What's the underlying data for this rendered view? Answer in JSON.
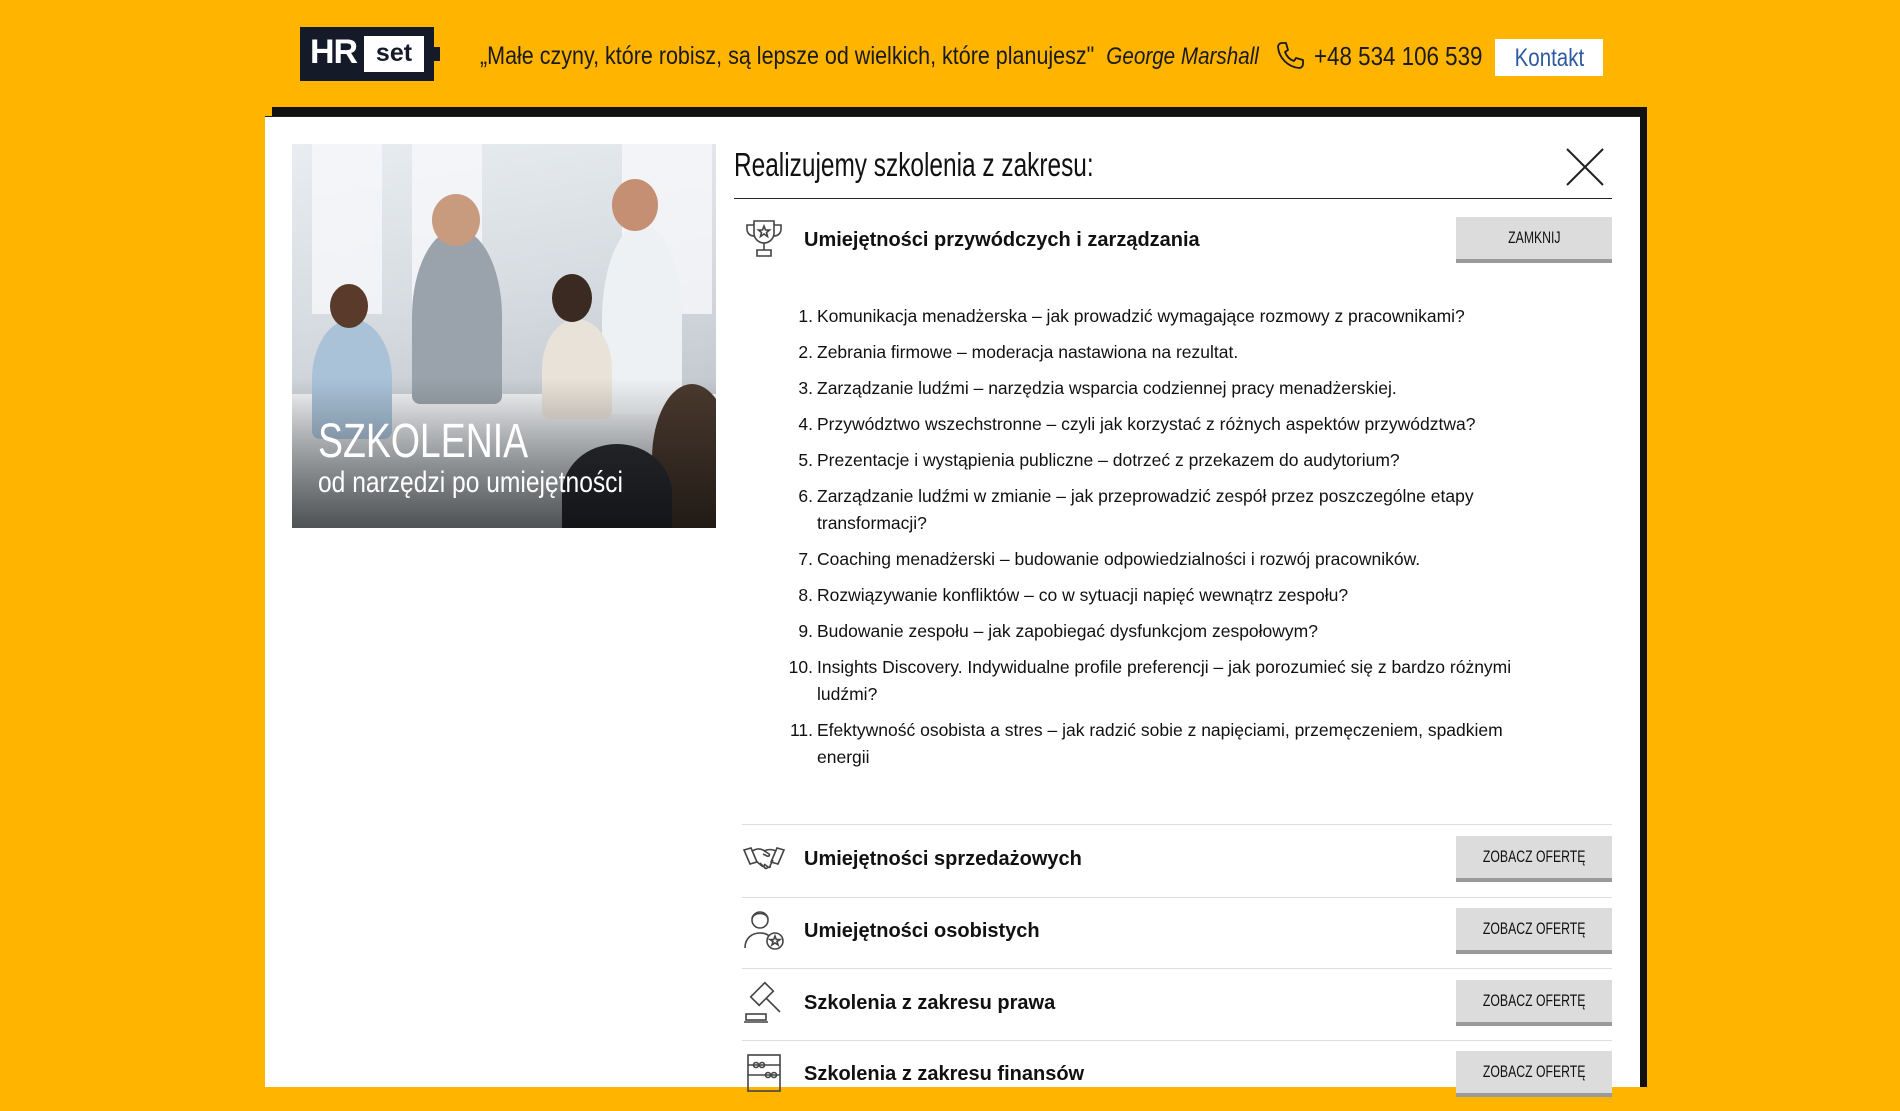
{
  "header": {
    "logo_hr": "HR",
    "logo_set": "set",
    "quote": "„Małe czyny, które robisz, są lepsze od wielkich, które planujesz\"",
    "quote_author": "George Marshall",
    "phone": "+48 534 106 539",
    "contact_label": "Kontakt",
    "icons": {
      "phone": "phone-icon"
    }
  },
  "modal": {
    "hero": {
      "title": "SZKOLENIA",
      "subtitle": "od narzędzi po umiejętności"
    },
    "title": "Realizujemy szkolenia z zakresu:",
    "close_icon": "close-icon",
    "sections": [
      {
        "icon": "trophy-icon",
        "label": "Umiejętności przywódczych i zarządzania",
        "button": "ZAMKNIJ",
        "expanded": true,
        "items": [
          "Komunikacja menadżerska – jak prowadzić wymagające rozmowy z pracownikami?",
          "Zebrania firmowe – moderacja nastawiona na rezultat.",
          "Zarządzanie ludźmi – narzędzia wsparcia codziennej pracy menadżerskiej.",
          "Przywództwo wszechstronne – czyli jak korzystać z różnych aspektów przywództwa?",
          "Prezentacje i wystąpienia publiczne – dotrzeć z przekazem do audytorium?",
          "Zarządzanie ludźmi w zmianie – jak przeprowadzić zespół przez poszczególne etapy transformacji?",
          "Coaching menadżerski – budowanie odpowiedzialności i rozwój pracowników.",
          "Rozwiązywanie konfliktów – co w sytuacji napięć wewnątrz zespołu?",
          "Budowanie zespołu – jak zapobiegać dysfunkcjom zespołowym?",
          "Insights Discovery. Indywidualne profile preferencji – jak porozumieć się z bardzo różnymi ludźmi?",
          "Efektywność osobista a stres – jak radzić sobie z napięciami, przemęczeniem, spadkiem energii"
        ]
      },
      {
        "icon": "handshake-icon",
        "label": "Umiejętności sprzedażowych",
        "button": "ZOBACZ OFERTĘ"
      },
      {
        "icon": "person-star-icon",
        "label": "Umiejętności osobistych",
        "button": "ZOBACZ OFERTĘ"
      },
      {
        "icon": "gavel-icon",
        "label": "Szkolenia z zakresu prawa",
        "button": "ZOBACZ OFERTĘ"
      },
      {
        "icon": "abacus-icon",
        "label": "Szkolenia z zakresu finansów",
        "button": "ZOBACZ OFERTĘ"
      }
    ]
  },
  "colors": {
    "background": "#FFB400",
    "logo_dark": "#151a28",
    "contact_text": "#2d5aa0",
    "button_bg": "#dcdcdc"
  }
}
